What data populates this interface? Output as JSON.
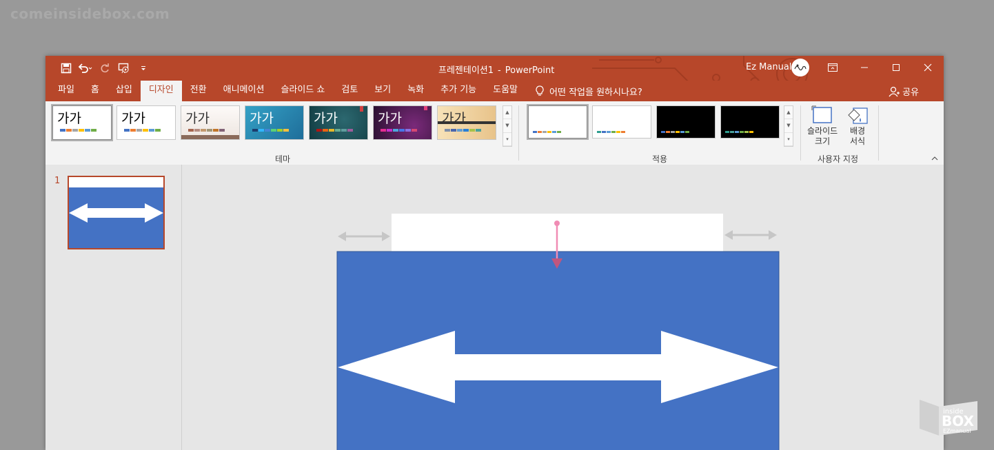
{
  "watermark": "comeinsidebox.com",
  "window": {
    "doc_name": "프레젠테이션1",
    "separator": "-",
    "app_name": "PowerPoint",
    "user_name": "Ez Manual",
    "accent": "#b7472a"
  },
  "tabs": [
    {
      "label": "파일"
    },
    {
      "label": "홈"
    },
    {
      "label": "삽입"
    },
    {
      "label": "디자인"
    },
    {
      "label": "전환"
    },
    {
      "label": "애니메이션"
    },
    {
      "label": "슬라이드 쇼"
    },
    {
      "label": "검토"
    },
    {
      "label": "보기"
    },
    {
      "label": "녹화"
    },
    {
      "label": "추가 기능"
    },
    {
      "label": "도움말"
    }
  ],
  "active_tab": "디자인",
  "tell_me": "어떤 작업을 원하시나요?",
  "share": "공유",
  "ribbon": {
    "themes_label": "테마",
    "variants_label": "적용",
    "customize_label": "사용자 지정",
    "theme_sample": "가가",
    "slide_size_line1": "슬라이드",
    "slide_size_line2": "크기",
    "format_bg_line1": "배경",
    "format_bg_line2": "서식"
  },
  "slides": {
    "current_number": "1"
  },
  "colors": {
    "slide_fill": "#4472c4",
    "arrow_fill": "#ffffff",
    "annotation_pink": "#f08cb4",
    "annotation_gray": "#c6c6c6"
  },
  "icons": [
    "save-icon",
    "undo-icon",
    "redo-icon",
    "start-from-beginning-icon",
    "customize-qat-icon",
    "lightbulb-icon",
    "share-person-icon",
    "ribbon-display-icon",
    "minimize-icon",
    "maximize-icon",
    "close-icon",
    "slide-size-icon",
    "format-background-icon",
    "collapse-ribbon-icon"
  ]
}
